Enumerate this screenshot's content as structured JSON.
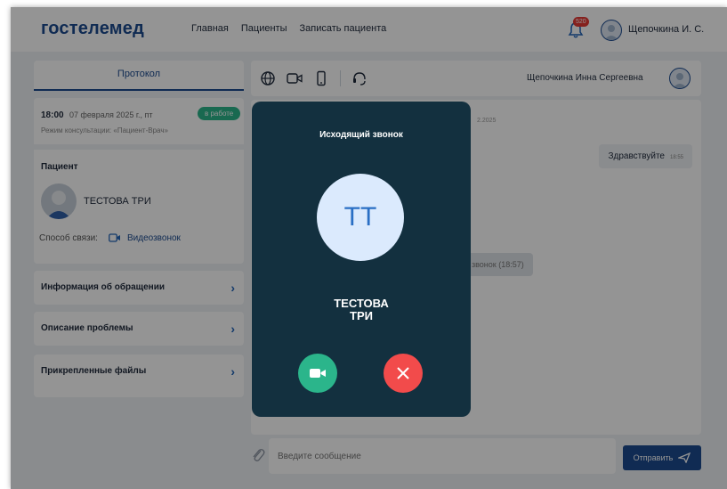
{
  "header": {
    "logo": "гостелемед",
    "nav": [
      "Главная",
      "Пациенты",
      "Записать пациента"
    ],
    "notification_count": "520",
    "user_name": "Щепочкина И. С."
  },
  "left": {
    "protocol_tab": "Протокол",
    "appointment": {
      "time": "18:00",
      "date": "07 февраля 2025 г., пт",
      "status": "в работе",
      "mode": "Режим консультации: «Пациент-Врач»"
    },
    "patient_label": "Пациент",
    "patient_name": "ТЕСТОВА ТРИ",
    "comm_label": "Способ связи:",
    "comm_value": "Видеозвонок",
    "sections": [
      "Информация об обращении",
      "Описание проблемы",
      "Прикрепленные файлы"
    ]
  },
  "chat": {
    "doctor_name": "Щепочкина Инна Сергеевна",
    "date_fragment": "2.2025",
    "message_hello": "Здравствуйте",
    "message_hello_time": "18:55",
    "system_fragment": "звонок (18:57)",
    "input_placeholder": "Введите сообщение",
    "send_label": "Отправить"
  },
  "call": {
    "title": "Исходящий звонок",
    "initials": "ТТ",
    "name_line1": "ТЕСТОВА",
    "name_line2": "ТРИ"
  },
  "colors": {
    "brand": "#1c4b8f",
    "modal_bg": "#13303f",
    "accept": "#2bb58b",
    "decline": "#f24b4b"
  },
  "icons": {
    "chat_toolbar": [
      "globe-icon",
      "video-camera-icon",
      "phone-icon",
      "headset-icon"
    ],
    "call_buttons": [
      "video-camera-icon",
      "close-icon"
    ]
  }
}
